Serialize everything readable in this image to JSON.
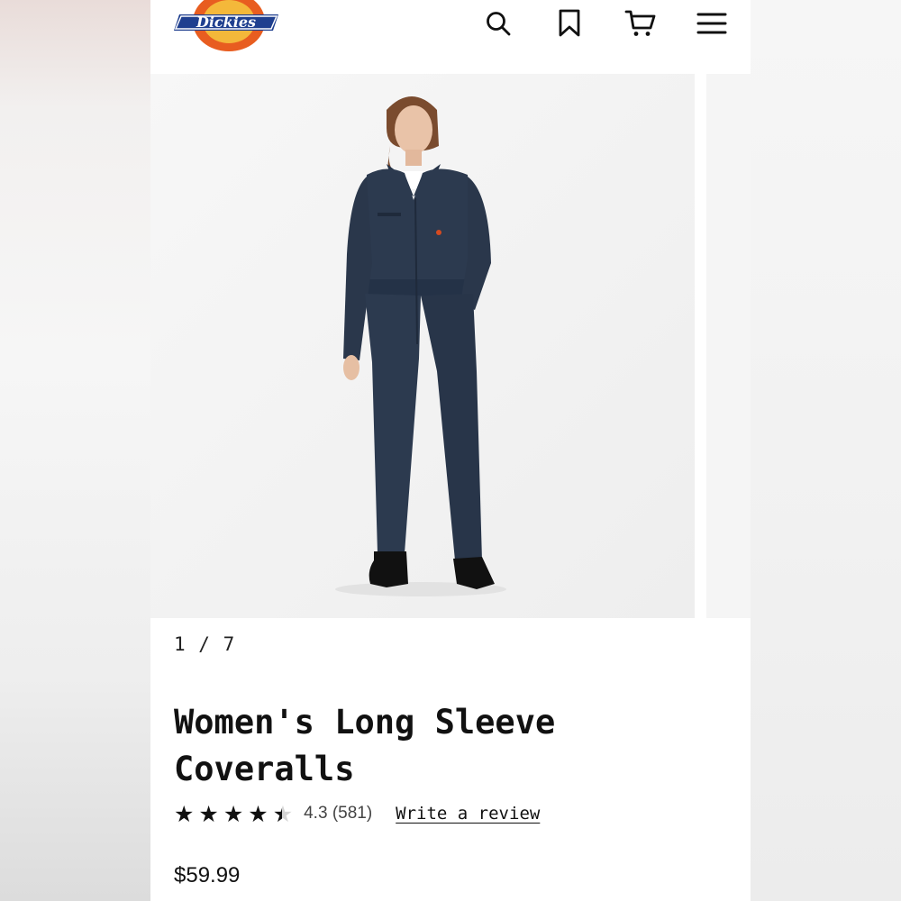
{
  "brand": {
    "logo_text": "Dickies",
    "colors": {
      "logo_orange": "#e85d20",
      "logo_blue": "#1f3f8f",
      "ink": "#111111"
    }
  },
  "header": {
    "icons": [
      "search-icon",
      "bookmark-icon",
      "cart-icon",
      "menu-icon"
    ]
  },
  "gallery": {
    "counter": "1 / 7",
    "current": 1,
    "total": 7,
    "product_color": "#2c3a4f"
  },
  "product": {
    "title": "Women's Long Sleeve Coveralls",
    "rating_value": 4.3,
    "rating_label": "4.3",
    "review_count": "(581)",
    "write_review": "Write a review",
    "price": "$59.99"
  }
}
